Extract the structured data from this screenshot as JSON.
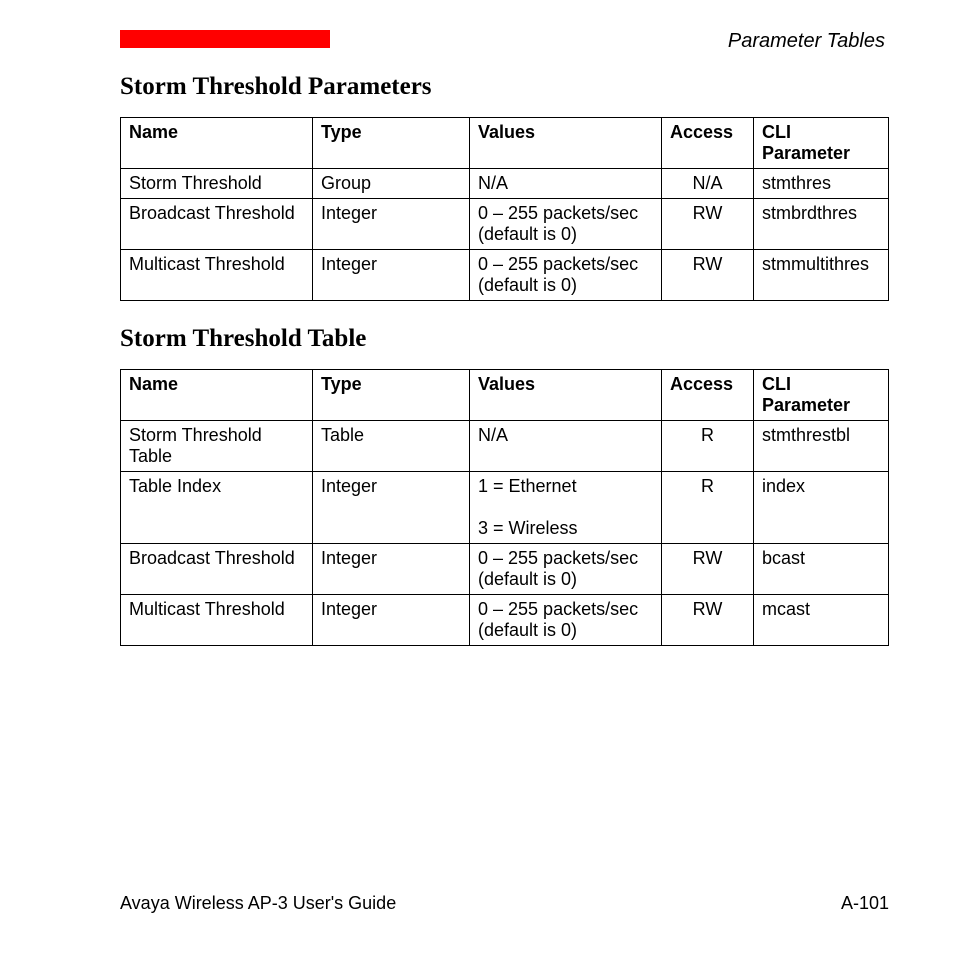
{
  "header": {
    "section_title": "Parameter Tables"
  },
  "section1": {
    "heading": "Storm Threshold Parameters",
    "columns": [
      "Name",
      "Type",
      "Values",
      "Access",
      "CLI Parameter"
    ],
    "rows": [
      {
        "name": "Storm Threshold",
        "type": "Group",
        "values": "N/A",
        "access": "N/A",
        "cli": "stmthres"
      },
      {
        "name": "Broadcast Threshold",
        "type": "Integer",
        "values": "0 – 255 packets/sec (default is 0)",
        "access": "RW",
        "cli": "stmbrdthres"
      },
      {
        "name": "Multicast Threshold",
        "type": "Integer",
        "values": "0 – 255 packets/sec (default is 0)",
        "access": "RW",
        "cli": "stmmultithres"
      }
    ]
  },
  "section2": {
    "heading": "Storm Threshold Table",
    "columns": [
      "Name",
      "Type",
      "Values",
      "Access",
      "CLI Parameter"
    ],
    "rows": [
      {
        "name": "Storm Threshold Table",
        "type": "Table",
        "values": "N/A",
        "access": "R",
        "cli": "stmthrestbl"
      },
      {
        "name": "Table Index",
        "type": "Integer",
        "values": "1 = Ethernet\n\n3 = Wireless",
        "access": "R",
        "cli": "index"
      },
      {
        "name": "Broadcast Threshold",
        "type": "Integer",
        "values": "0 – 255 packets/sec (default is 0)",
        "access": "RW",
        "cli": "bcast"
      },
      {
        "name": "Multicast Threshold",
        "type": "Integer",
        "values": "0 – 255 packets/sec (default is 0)",
        "access": "RW",
        "cli": "mcast"
      }
    ]
  },
  "footer": {
    "guide": "Avaya Wireless AP-3 User's Guide",
    "page": "A-101"
  }
}
